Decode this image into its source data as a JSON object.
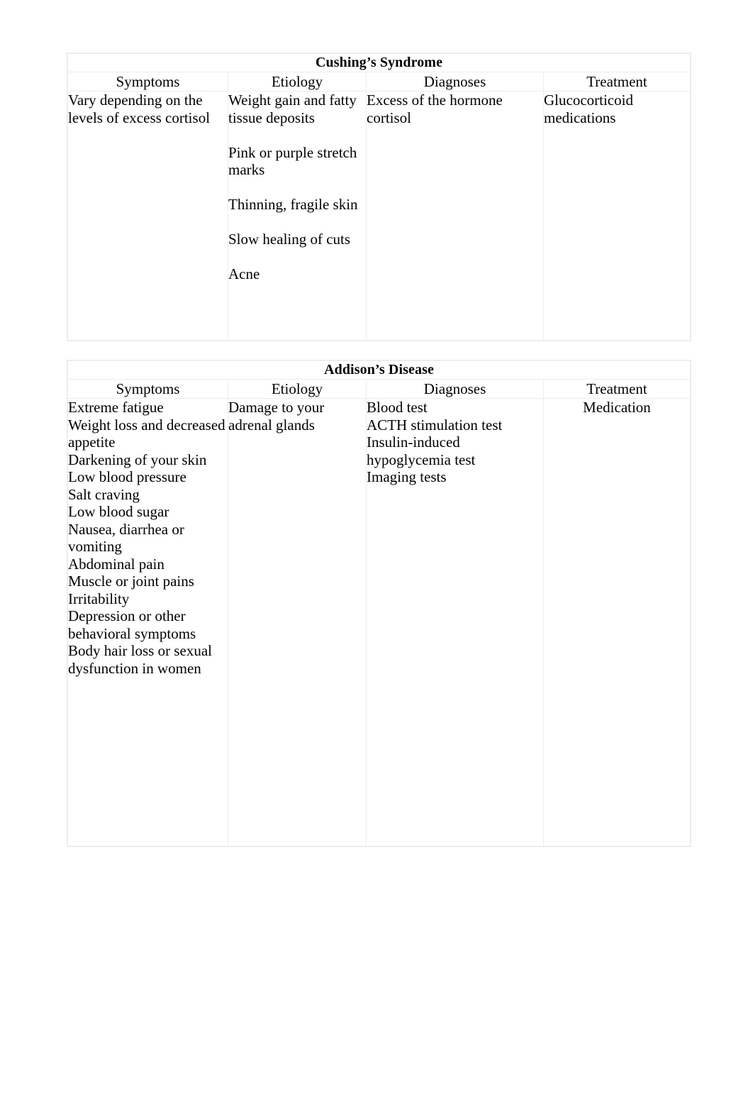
{
  "document": {
    "background_color": "#ffffff",
    "header_fill": "#efefef",
    "border_color": "#ededed",
    "text_color": "#000000"
  },
  "tables": [
    {
      "title": "Cushing’s Syndrome",
      "columns": [
        "Symptoms",
        "Etiology",
        "Diagnoses",
        "Treatment"
      ],
      "cells": {
        "symptoms": {
          "align": "left",
          "items": [
            "Vary depending on the levels of excess cortisol"
          ],
          "spaced": false
        },
        "etiology": {
          "align": "left",
          "items": [
            "Weight gain and fatty tissue deposits",
            "Pink or purple stretch marks",
            "Thinning, fragile skin",
            "Slow healing of cuts",
            "Acne"
          ],
          "spaced": true
        },
        "diagnoses": {
          "align": "left",
          "items": [
            "Excess of the hormone cortisol"
          ],
          "spaced": false
        },
        "treatment": {
          "align": "left",
          "items": [
            "Glucocorticoid medications"
          ],
          "spaced": false
        }
      }
    },
    {
      "title": "Addison’s Disease",
      "columns": [
        "Symptoms",
        "Etiology",
        "Diagnoses",
        "Treatment"
      ],
      "cells": {
        "symptoms": {
          "align": "left",
          "items": [
            "Extreme fatigue",
            "Weight loss and decreased appetite",
            "Darkening of your skin",
            "Low blood pressure",
            "Salt craving",
            "Low blood sugar",
            "Nausea, diarrhea or vomiting",
            "Abdominal pain",
            "Muscle or joint pains",
            "Irritability",
            "Depression or other behavioral symptoms",
            "Body hair loss or sexual dysfunction in women"
          ],
          "spaced": false
        },
        "etiology": {
          "align": "left",
          "items": [
            "Damage to your adrenal glands"
          ],
          "spaced": false
        },
        "diagnoses": {
          "align": "left",
          "items": [
            "Blood test",
            "ACTH stimulation test",
            "Insulin-induced hypoglycemia test",
            "Imaging tests"
          ],
          "spaced": false
        },
        "treatment": {
          "align": "center",
          "items": [
            "Medication"
          ],
          "spaced": false
        }
      }
    }
  ]
}
